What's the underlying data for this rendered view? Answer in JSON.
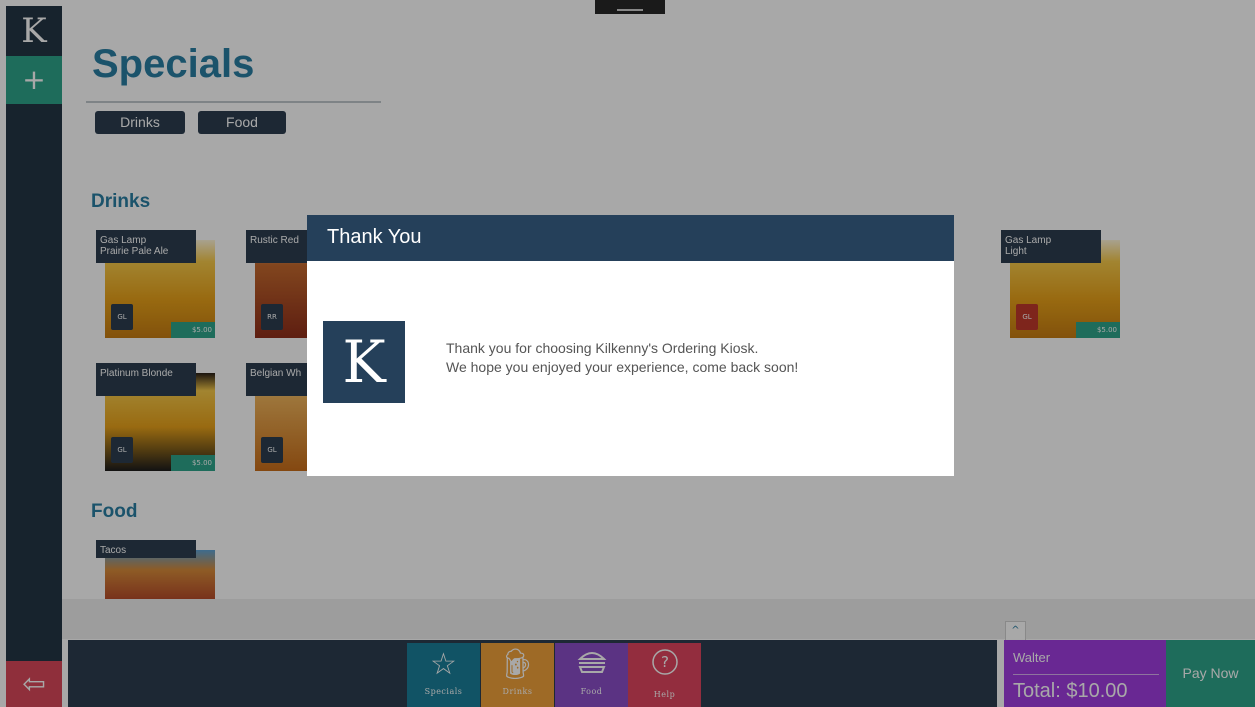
{
  "rail": {
    "logo": "K",
    "add": "+",
    "exit": "⇦"
  },
  "page": {
    "title": "Specials",
    "filters": [
      "Drinks",
      "Food"
    ]
  },
  "sections": {
    "drinks": {
      "title": "Drinks",
      "items": [
        {
          "name": "Gas Lamp\nPrairie Pale Ale",
          "price": "$5.00"
        },
        {
          "name": "Rustic Red",
          "price": ""
        },
        {
          "name": "Gas Lamp\nLight",
          "price": "$5.00"
        },
        {
          "name": "Platinum Blonde",
          "price": "$5.00"
        },
        {
          "name": "Belgian Wh",
          "price": ""
        }
      ]
    },
    "food": {
      "title": "Food",
      "items": [
        {
          "name": "Tacos"
        }
      ]
    }
  },
  "nav": [
    {
      "label": "Specials",
      "icon": "star-icon"
    },
    {
      "label": "Drinks",
      "icon": "beer-mug-icon"
    },
    {
      "label": "Food",
      "icon": "burger-icon"
    },
    {
      "label": "Help",
      "icon": "question-icon"
    }
  ],
  "order": {
    "expand": "^",
    "customer": "Walter",
    "total": "Total: $10.00",
    "pay_label": "Pay Now"
  },
  "dialog": {
    "title": "Thank You",
    "logo": "K",
    "line1": "Thank you for choosing Kilkenny's Ordering Kiosk.",
    "line2": "We hope you enjoyed your experience, come back soon!"
  },
  "colors": {
    "rail": "#243645",
    "accent_green": "#2ea58a",
    "accent_blue_text": "#2a7ea3",
    "nav_specials": "#1b7f99",
    "nav_drinks": "#f0a23b",
    "nav_food": "#8a4ec7",
    "nav_help": "#e0455e",
    "order_purple": "#a03ee0",
    "dialog_header": "#25405a"
  }
}
